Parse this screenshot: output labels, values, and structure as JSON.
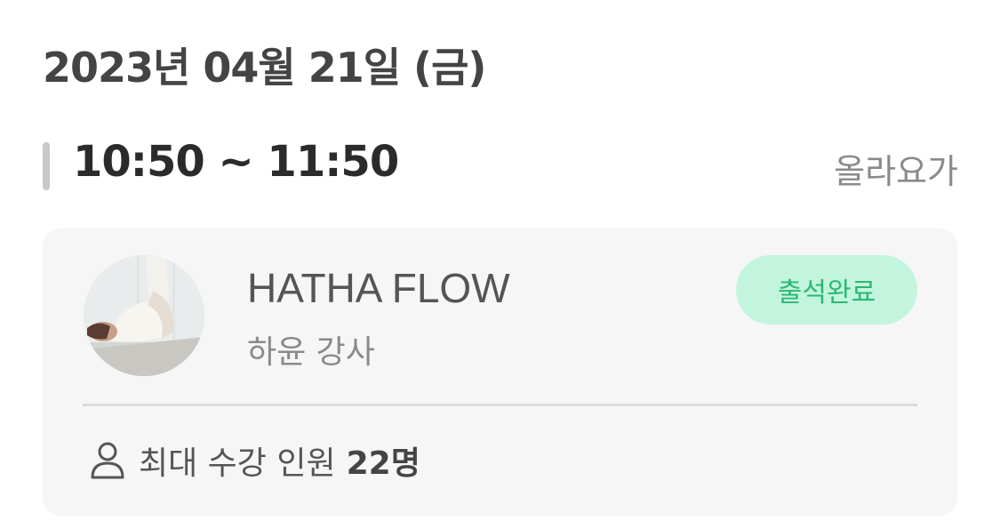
{
  "header": {
    "date": "2023년 04월 21일 (금)"
  },
  "session": {
    "time_range": "10:50 ~ 11:50",
    "studio": "올라요가"
  },
  "card": {
    "class_name": "HATHA FLOW",
    "instructor": "하윤 강사",
    "status_badge": "출석완료",
    "capacity_label": "최대 수강 인원",
    "capacity_value": "22명"
  },
  "icons": {
    "avatar": "instructor-photo",
    "capacity": "person-icon"
  },
  "colors": {
    "badge_background": "#c3f5de",
    "badge_text": "#2bb873",
    "card_background": "#f6f6f6",
    "accent_bar": "#c8c8c8"
  }
}
